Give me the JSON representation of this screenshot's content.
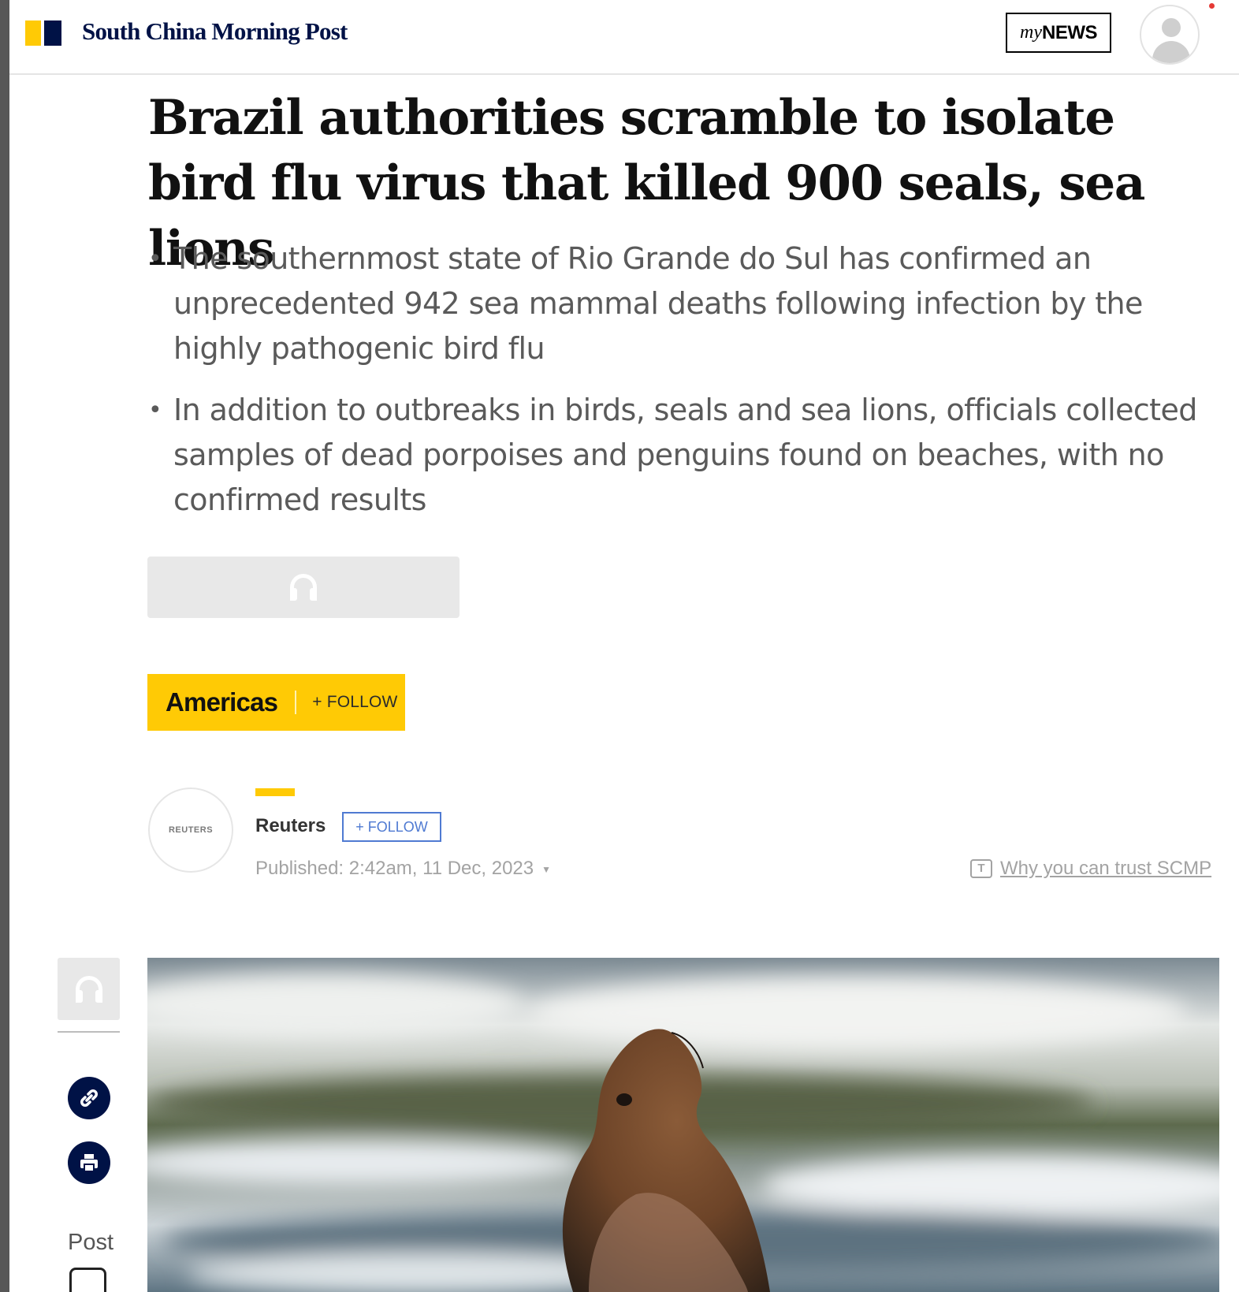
{
  "header": {
    "brand": "South China Morning Post",
    "mynews_prefix": "my",
    "mynews_label": "NEWS"
  },
  "article": {
    "headline": "Brazil authorities scramble to isolate bird flu virus that killed 900 seals, sea lions",
    "bullets": [
      "The southernmost state of Rio Grande do Sul has confirmed an unprecedented 942 sea mammal deaths following infection by the highly pathogenic bird flu",
      "In addition to outbreaks in birds, seals and sea lions, officials collected samples of dead porpoises and penguins found on beaches, with no confirmed results"
    ],
    "topic": {
      "name": "Americas",
      "follow_label": "+ FOLLOW"
    },
    "author": {
      "avatar_text": "REUTERS",
      "name": "Reuters",
      "follow_label": "+ FOLLOW",
      "published": "Published: 2:42am, 11 Dec, 2023",
      "trust_icon_text": "T",
      "trust_link": "Why you can trust SCMP"
    }
  },
  "sidebar": {
    "post_label": "Post"
  },
  "icons": {
    "audio": "headphones-icon",
    "link": "link-icon",
    "print": "print-icon",
    "menu": "hamburger-menu-icon",
    "user": "user-avatar-icon"
  },
  "colors": {
    "brand_navy": "#001246",
    "brand_yellow": "#ffca05",
    "follow_blue": "#4f7ad2"
  }
}
